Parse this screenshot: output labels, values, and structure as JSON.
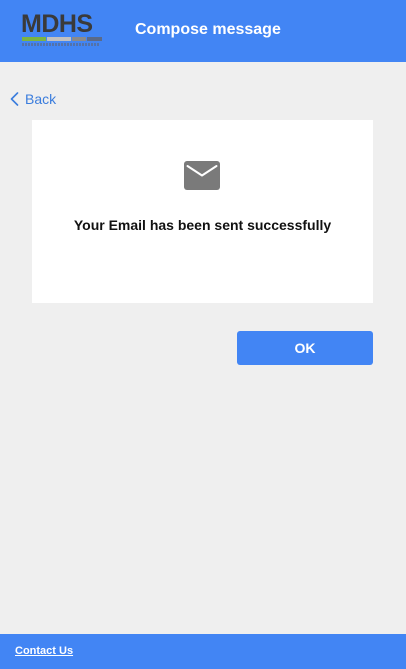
{
  "header": {
    "logo_text": "MDHS",
    "title": "Compose message",
    "background": "#4285f4",
    "logo_bar_colors": [
      "#7cb342",
      "#c0c0c0",
      "#8a8a8a",
      "#5a6a8a"
    ]
  },
  "nav": {
    "back_label": "Back",
    "back_icon": "chevron-left-icon",
    "link_color": "#3b7ddd"
  },
  "confirmation": {
    "icon": "mail-icon",
    "icon_color": "#7a7a7a",
    "message": "Your Email has been sent successfully"
  },
  "actions": {
    "ok_label": "OK",
    "button_color": "#4285f4"
  },
  "footer": {
    "contact_label": "Contact Us",
    "background": "#4285f4"
  }
}
